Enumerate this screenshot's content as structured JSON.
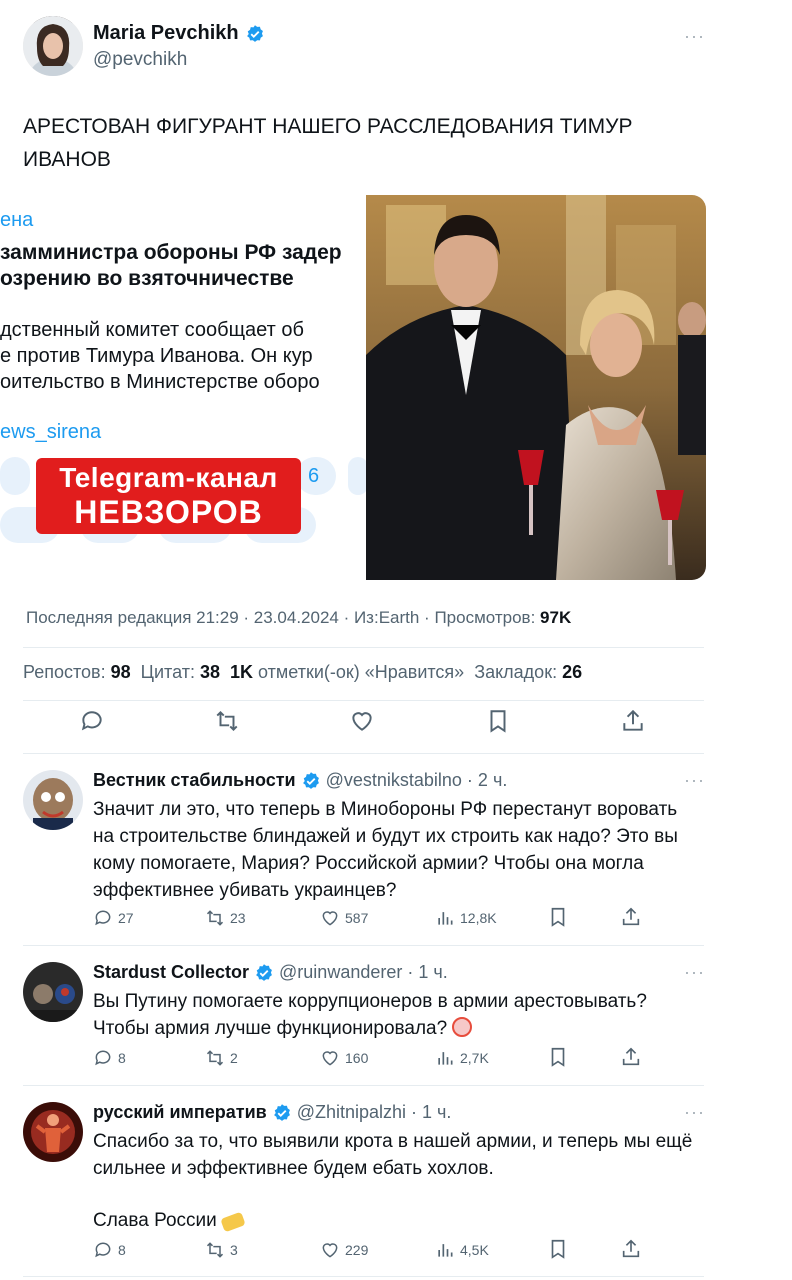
{
  "post": {
    "author_name": "Maria Pevchikh",
    "author_handle": "@pevchikh",
    "more": "···",
    "text": "АРЕСТОВАН ФИГУРАНТ НАШЕГО РАССЛЕДОВАНИЯ ТИМУР ИВАНОВ",
    "embedded": {
      "channel": "ена",
      "headline_1": "замминистра обороны РФ задер",
      "headline_2": "озрению во взяточничестве",
      "body_1": "дственный комитет сообщает об",
      "body_2": "е против Тимура Иванова. Он кур",
      "body_3": "оительство в Министерстве оборо",
      "link": "ews_sirena",
      "count": "6",
      "badge_line1": "Telegram-канал",
      "badge_line2": "НЕВЗОРОВ"
    },
    "meta": {
      "edited_label": "Последняя редакция 21:29 · 23.04.2024 · Из:Earth · Просмотров:",
      "views": "97K"
    },
    "stats": {
      "reposts_label": "Репостов:",
      "reposts": "98",
      "quotes_label": "Цитат:",
      "quotes": "38",
      "likes": "1K",
      "likes_label": "отметки(-ок) «Нравится»",
      "bookmarks_label": "Закладок:",
      "bookmarks": "26"
    }
  },
  "replies": [
    {
      "name": "Вестник стабильности",
      "handle": "@vestnikstabilno · 2 ч.",
      "text_lines": [
        "Значит ли это, что теперь в Минобороны РФ перестанут воровать",
        "на строительстве блиндажей и будут их строить как надо? Это вы",
        "кому помогаете, Мария? Российской армии? Чтобы она могла",
        "эффективнее убивать украинцев?"
      ],
      "replies": "27",
      "reposts": "23",
      "likes": "587",
      "views": "12,8K"
    },
    {
      "name": "Stardust Collector",
      "handle": "@ruinwanderer · 1 ч.",
      "text_lines": [
        "Вы Путину помогаете коррупционеров в армии арестовывать?",
        "Чтобы армия лучше функционировала?"
      ],
      "replies": "8",
      "reposts": "2",
      "likes": "160",
      "views": "2,7K"
    },
    {
      "name": "русский императив",
      "handle": "@Zhitnipalzhi · 1 ч.",
      "text_lines": [
        "Спасибо за то, что выявили крота в нашей армии, и теперь мы ещё",
        "сильнее и эффективнее будем ебать хохлов.",
        "",
        "Слава России"
      ],
      "replies": "8",
      "reposts": "3",
      "likes": "229",
      "views": "4,5K"
    }
  ],
  "colors": {
    "accent": "#1d9bf0",
    "text": "#0f1419",
    "muted": "#536471",
    "badge_red": "#e11d1d"
  }
}
